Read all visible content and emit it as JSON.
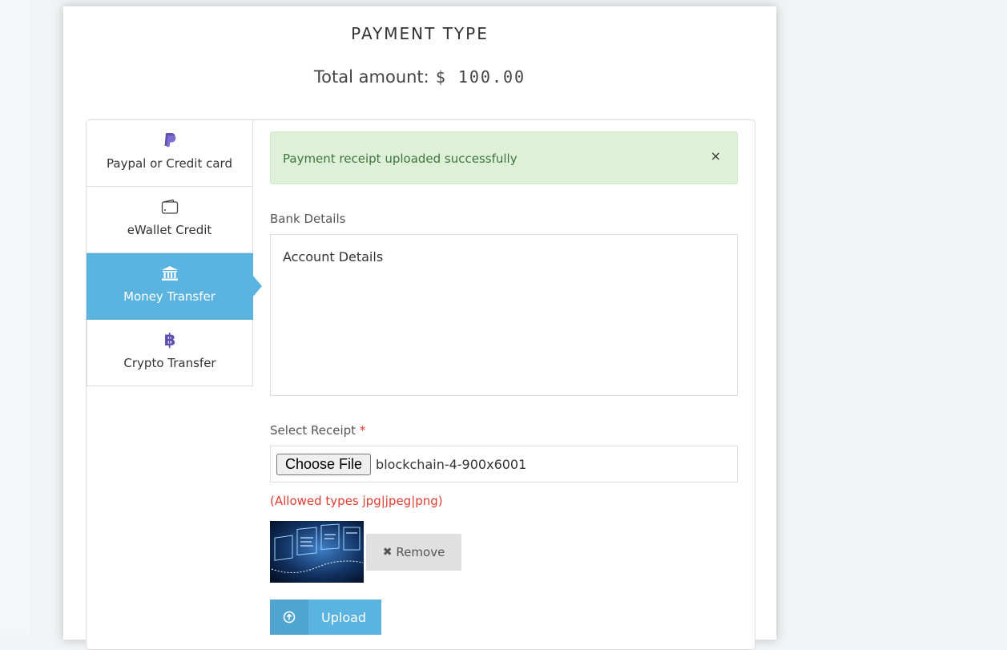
{
  "header": {
    "title": "PAYMENT TYPE",
    "total_label": "Total amount:",
    "total_value": "$ 100.00"
  },
  "tabs": [
    {
      "label": "Paypal or Credit card",
      "icon": "paypal-icon",
      "active": false
    },
    {
      "label": "eWallet Credit",
      "icon": "wallet-icon",
      "active": false
    },
    {
      "label": "Money Transfer",
      "icon": "bank-icon",
      "active": true
    },
    {
      "label": "Crypto Transfer",
      "icon": "bitcoin-icon",
      "active": false
    }
  ],
  "alert": {
    "message": "Payment receipt uploaded successfully",
    "close": "×"
  },
  "bank": {
    "label": "Bank Details",
    "content": "Account Details"
  },
  "receipt": {
    "label": "Select Receipt",
    "required_mark": "*",
    "choose_button": "Choose File",
    "file_name": "blockchain-4-900x6001",
    "allowed_types": "(Allowed types jpg|jpeg|png)"
  },
  "actions": {
    "remove_label": "Remove",
    "upload_label": "Upload"
  },
  "colors": {
    "accent": "#5bb4df",
    "success_bg": "#dff0d8",
    "success_text": "#3c763d",
    "error_text": "#e03b30",
    "icon_purple": "#5e4fb0"
  }
}
